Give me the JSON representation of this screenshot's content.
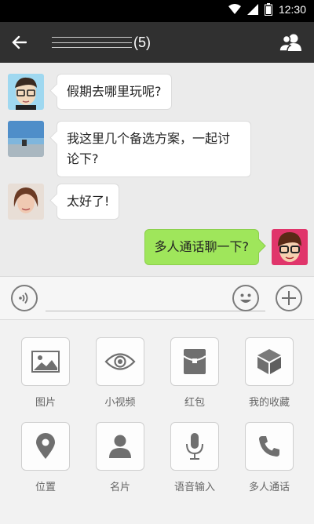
{
  "status_bar": {
    "time": "12:30"
  },
  "titlebar": {
    "title_suffix": "(5)"
  },
  "messages": [
    {
      "side": "left",
      "text": "假期去哪里玩呢?"
    },
    {
      "side": "left",
      "text": "我这里几个备选方案，一起讨论下?"
    },
    {
      "side": "left",
      "text": "太好了!"
    },
    {
      "side": "right",
      "text": "多人通话聊一下?"
    }
  ],
  "input": {
    "value": "",
    "placeholder": ""
  },
  "panel": {
    "items": [
      {
        "label": "图片",
        "icon": "image-icon"
      },
      {
        "label": "小视频",
        "icon": "eye-icon"
      },
      {
        "label": "红包",
        "icon": "red-packet-icon"
      },
      {
        "label": "我的收藏",
        "icon": "cube-icon"
      },
      {
        "label": "位置",
        "icon": "location-pin-icon"
      },
      {
        "label": "名片",
        "icon": "person-card-icon"
      },
      {
        "label": "语音输入",
        "icon": "microphone-icon"
      },
      {
        "label": "多人通话",
        "icon": "phone-icon"
      }
    ]
  },
  "colors": {
    "titlebar": "#303030",
    "chat_bg": "#ebebeb",
    "sent_bubble": "#9fe65b"
  }
}
